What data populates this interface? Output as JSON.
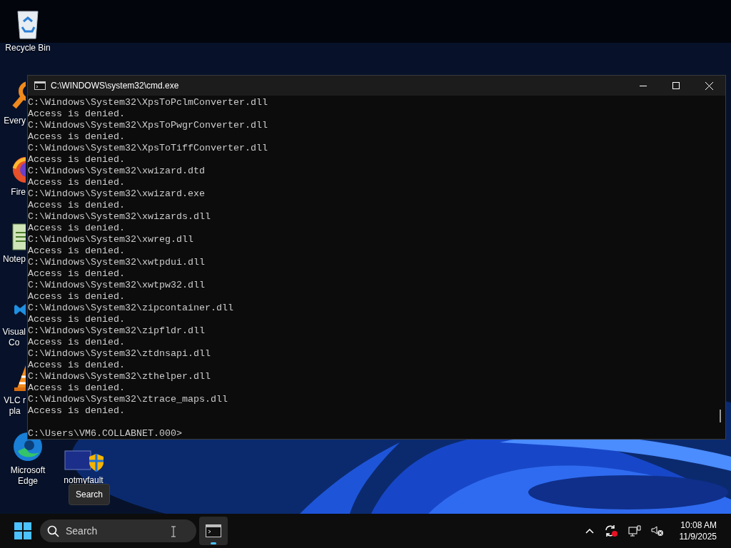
{
  "desktop_icons": [
    {
      "kind": "recycle",
      "lines": [
        "Recycle Bin"
      ]
    },
    {
      "kind": "everything",
      "lines": [
        "Every"
      ]
    },
    {
      "kind": "firefox",
      "lines": [
        "Fire"
      ]
    },
    {
      "kind": "notepad",
      "lines": [
        "Notep"
      ]
    },
    {
      "kind": "vscode",
      "lines": [
        "Visual",
        "Co"
      ]
    },
    {
      "kind": "vlc",
      "lines": [
        "VLC r",
        "pla"
      ]
    },
    {
      "kind": "edge",
      "lines": [
        "Microsoft",
        "Edge"
      ]
    },
    {
      "kind": "notmyfault",
      "lines": [
        "notmyfault"
      ]
    }
  ],
  "window": {
    "title": "C:\\WINDOWS\\system32\\cmd.exe",
    "lines": [
      "C:\\Windows\\System32\\XpsToPclmConverter.dll",
      "Access is denied.",
      "C:\\Windows\\System32\\XpsToPwgrConverter.dll",
      "Access is denied.",
      "C:\\Windows\\System32\\XpsToTiffConverter.dll",
      "Access is denied.",
      "C:\\Windows\\System32\\xwizard.dtd",
      "Access is denied.",
      "C:\\Windows\\System32\\xwizard.exe",
      "Access is denied.",
      "C:\\Windows\\System32\\xwizards.dll",
      "Access is denied.",
      "C:\\Windows\\System32\\xwreg.dll",
      "Access is denied.",
      "C:\\Windows\\System32\\xwtpdui.dll",
      "Access is denied.",
      "C:\\Windows\\System32\\xwtpw32.dll",
      "Access is denied.",
      "C:\\Windows\\System32\\zipcontainer.dll",
      "Access is denied.",
      "C:\\Windows\\System32\\zipfldr.dll",
      "Access is denied.",
      "C:\\Windows\\System32\\ztdnsapi.dll",
      "Access is denied.",
      "C:\\Windows\\System32\\zthelper.dll",
      "Access is denied.",
      "C:\\Windows\\System32\\ztrace_maps.dll",
      "Access is denied."
    ],
    "prompt": "C:\\Users\\VM6.COLLABNET.000>"
  },
  "tooltip": "Search",
  "taskbar": {
    "search_placeholder": "Search",
    "apps": [
      {
        "kind": "cmd",
        "selected": true
      }
    ],
    "time": "10:08 AM",
    "date": "11/9/2025"
  }
}
